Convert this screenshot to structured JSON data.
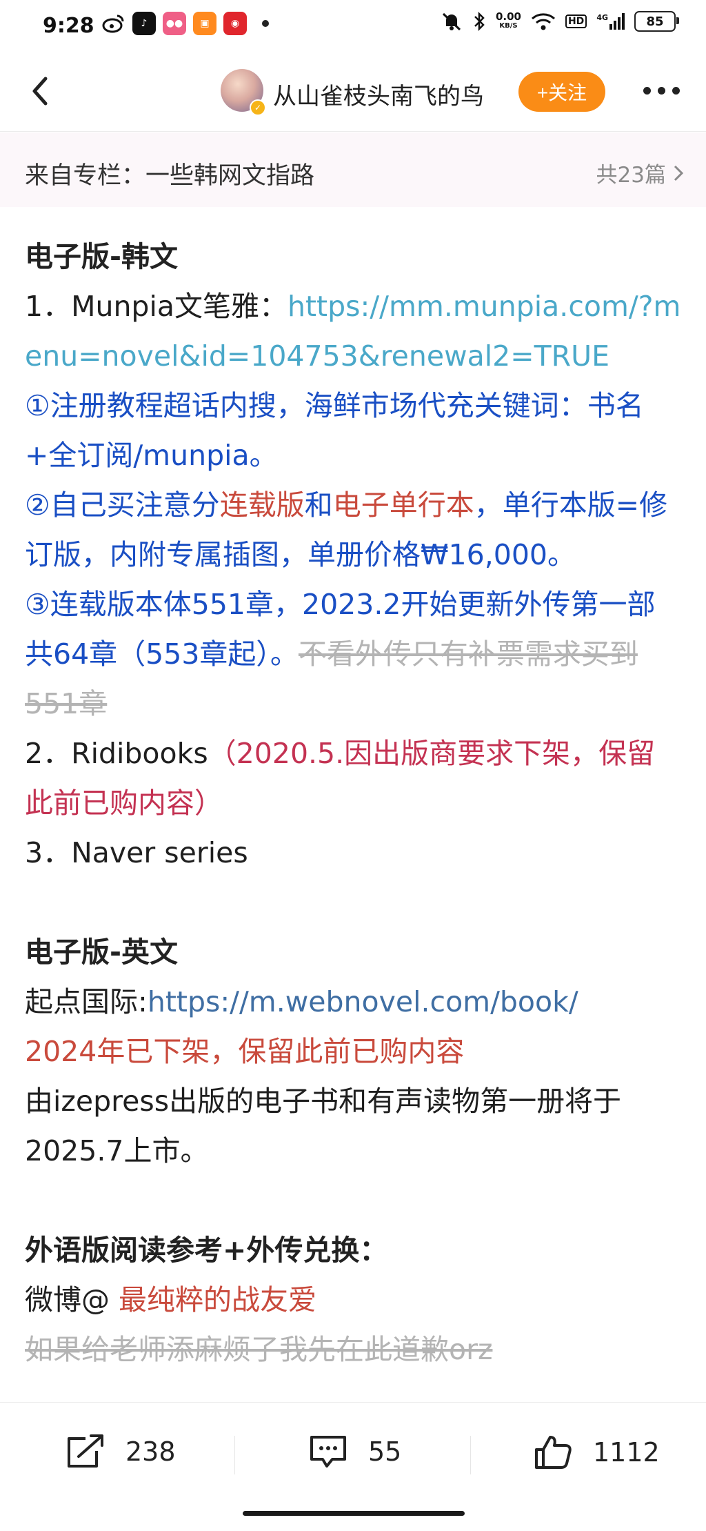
{
  "status_bar": {
    "time": "9:28",
    "net_speed_value": "0.00",
    "net_speed_unit": "KB/S",
    "hd": "HD",
    "signal": "4G",
    "battery": "85"
  },
  "nav": {
    "author": "从山雀枝头南飞的鸟",
    "follow_label": "+关注"
  },
  "column": {
    "title": "来自专栏：一些韩网文指路",
    "count": "共23篇"
  },
  "content": {
    "h_korean": "电子版-韩文",
    "k1_label": "1．Munpia文笔雅：",
    "k1_url": "https://mm.munpia.com/?menu=novel&id=104753&renewal2=TRUE",
    "k1_note1": "①注册教程超话内搜，海鲜市场代充关键词：书名+全订阅/munpia。",
    "k1_note2_a": "②自己买注意分",
    "k1_note2_b": "连载版",
    "k1_note2_c": "和",
    "k1_note2_d": "电子单行本",
    "k1_note2_e": "，单行本版=修订版，内附专属插图，单册价格₩16,000。",
    "k1_note3_a": "③连载版本体551章，2023.2开始更新外传第一部共64章（553章起）。",
    "k1_note3_b": "不看外传只有补票需求买到551章",
    "k2_label": "2．Ridibooks",
    "k2_note": "（2020.5.因出版商要求下架，保留此前已购内容）",
    "k3_label": "3．Naver series",
    "h_english": "电子版-英文",
    "e1_label": "起点国际:",
    "e1_url": "https://m.webnovel.com/book/",
    "e1_note": "2024年已下架，保留此前已购内容",
    "e2": "由izepress出版的电子书和有声读物第一册将于2025.7上市。",
    "h_foreign": "外语版阅读参考+外传兑换：",
    "weibo_label": "微博@",
    "weibo_user": "最纯粹的战友爱",
    "apology": "如果给老师添麻烦了我先在此道歉orz"
  },
  "actions": {
    "share_count": "238",
    "comment_count": "55",
    "like_count": "1112"
  },
  "colors": {
    "accent_follow": "#fa8c16",
    "link": "#4aa8c9",
    "blue_text": "#1a4fc4",
    "red_text": "#c94a3c",
    "crimson_text": "#c43252"
  }
}
